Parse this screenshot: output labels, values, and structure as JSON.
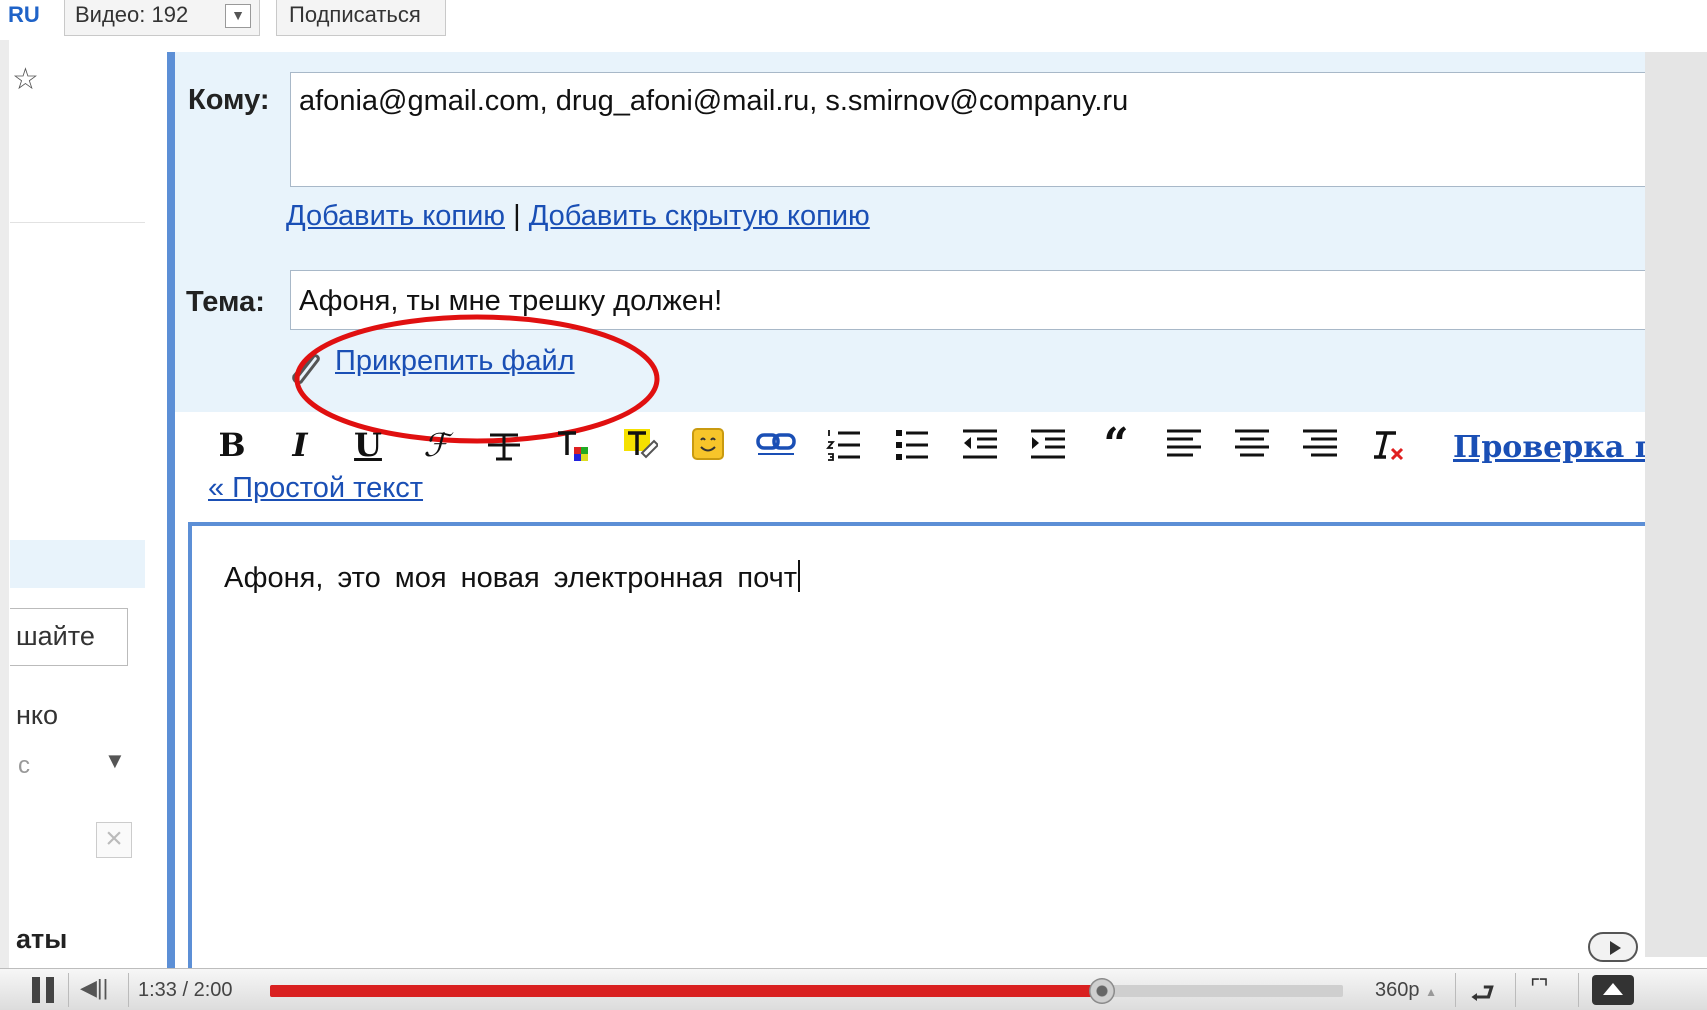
{
  "top_bar": {
    "logo": "RU",
    "video_count_label": "Видео: 192",
    "subscribe_label": "Подписаться"
  },
  "sidebar": {
    "input_text": "шайте",
    "name_text": "нко",
    "status_text": "с",
    "bottom_text": "аты"
  },
  "compose": {
    "to_label": "Кому:",
    "to_value": "afonia@gmail.com,  drug_afoni@mail.ru,  s.smirnov@company.ru",
    "add_cc": "Добавить копию",
    "separator": "|",
    "add_bcc": "Добавить скрытую копию",
    "subject_label": "Тема:",
    "subject_value": "Афоня, ты мне трешку должен!",
    "attach_label": "Прикрепить файл",
    "spellcheck_label": "Проверка п",
    "plain_text_label": "« Простой текст",
    "body_text": "Афоня, это моя новая электронная почт"
  },
  "player": {
    "time": "1:33 / 2:00",
    "progress_fraction": 0.775,
    "quality": "360p"
  },
  "colors": {
    "accent_blue": "#5c8fd6",
    "link_blue": "#1a4fb5",
    "panel_bg": "#e8f3fb",
    "highlight_red": "#e01010",
    "progress_red": "#d92020"
  }
}
